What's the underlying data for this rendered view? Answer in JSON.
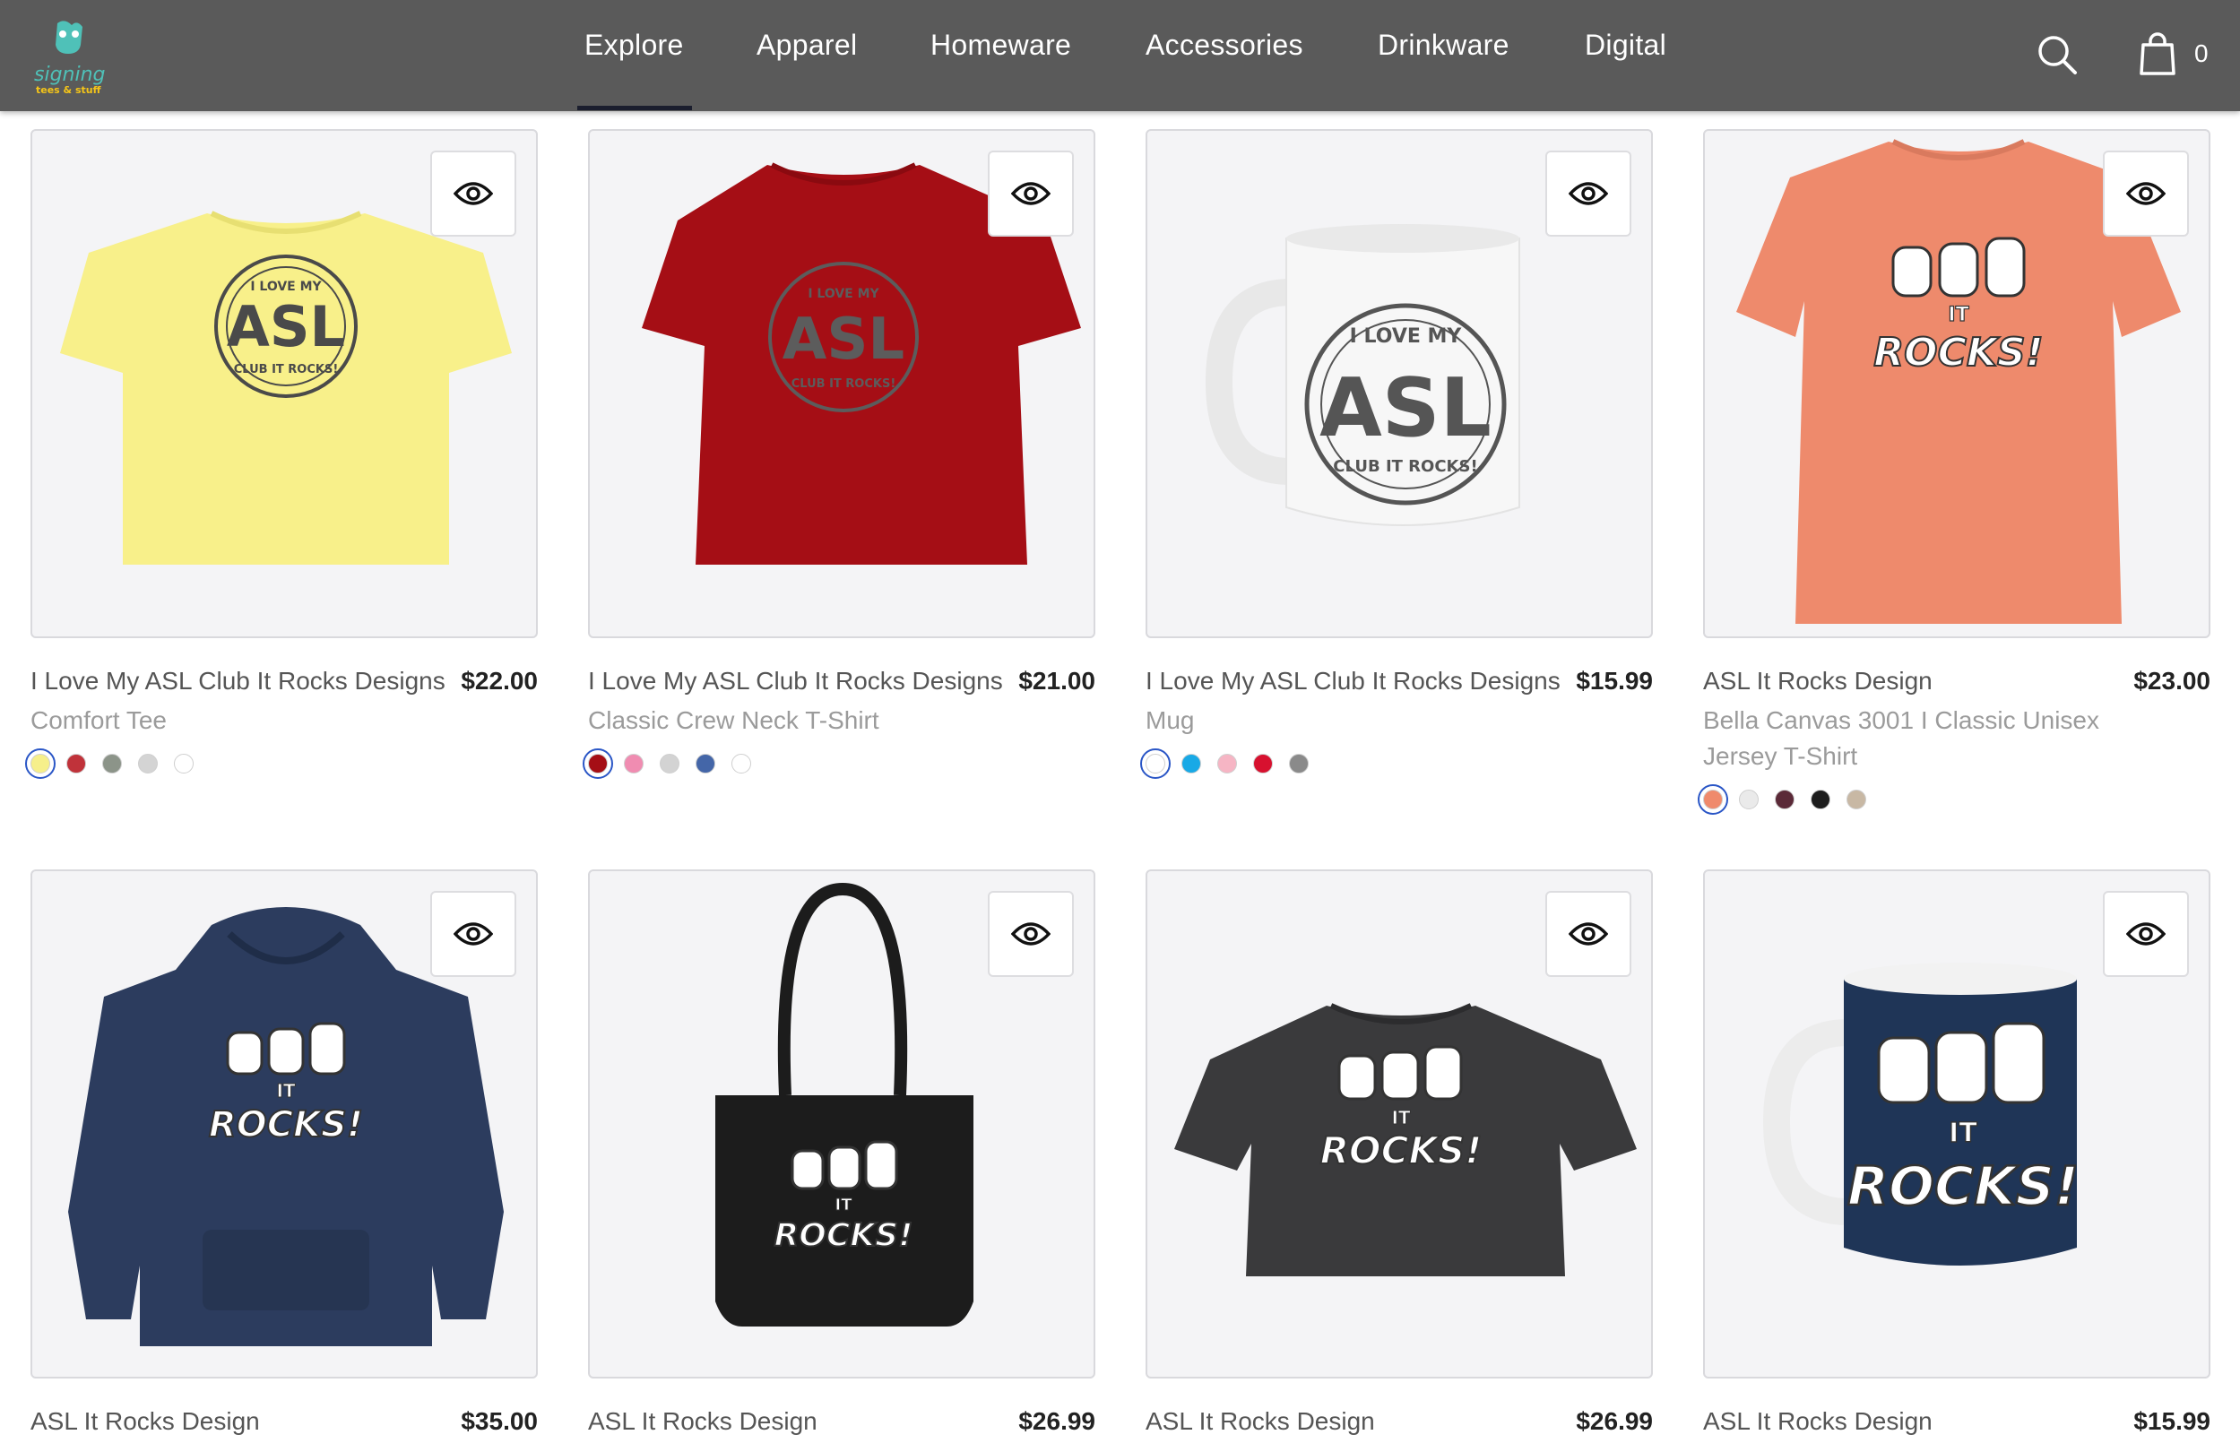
{
  "brand": {
    "logo_text": "signing",
    "logo_sub": "tees & stuff"
  },
  "nav": {
    "items": [
      "Explore",
      "Apparel",
      "Homeware",
      "Accessories",
      "Drinkware",
      "Digital"
    ],
    "active": "Explore"
  },
  "header": {
    "cart_count": "0"
  },
  "products": [
    {
      "title": "I Love My ASL Club It Rocks Designs",
      "subtitle": "Comfort Tee",
      "price": "$22.00",
      "swatches": [
        "#f6ef8a",
        "#c0323a",
        "#8c9489",
        "#d4d4d4",
        "#ffffff"
      ]
    },
    {
      "title": "I Love My ASL Club It Rocks Designs",
      "subtitle": "Classic Crew Neck T-Shirt",
      "price": "$21.00",
      "swatches": [
        "#a50e15",
        "#f08cb1",
        "#d3d3d3",
        "#4466a8",
        "#ffffff"
      ]
    },
    {
      "title": "I Love My ASL Club It Rocks Designs",
      "subtitle": "Mug",
      "price": "$15.99",
      "swatches": [
        "#ffffff",
        "#18a9e6",
        "#f6b5c4",
        "#d7112f",
        "#8a8a8a"
      ]
    },
    {
      "title": "ASL It Rocks Design",
      "subtitle": "Bella Canvas 3001 I Classic Unisex Jersey T-Shirt",
      "price": "$23.00",
      "swatches": [
        "#ef8a6c",
        "#eaeaea",
        "#5b2a38",
        "#1d1d1d",
        "#c8b8a4"
      ]
    },
    {
      "title": "ASL It Rocks Design",
      "subtitle": "",
      "price": "$35.00",
      "swatches": []
    },
    {
      "title": "ASL It Rocks Design",
      "subtitle": "",
      "price": "$26.99",
      "swatches": []
    },
    {
      "title": "ASL It Rocks Design",
      "subtitle": "",
      "price": "$26.99",
      "swatches": []
    },
    {
      "title": "ASL It Rocks Design",
      "subtitle": "",
      "price": "$15.99",
      "swatches": []
    }
  ],
  "artwork": {
    "asl_badge": {
      "top": "I LOVE MY",
      "middle": "ASL",
      "bottom": "CLUB IT ROCKS!"
    },
    "it_rocks": {
      "small": "IT",
      "big": "ROCKS!"
    }
  },
  "colors": {
    "header_bg": "#5a5a5a",
    "selected_ring": "#2a56c6",
    "card_bg": "#f4f4f6"
  }
}
